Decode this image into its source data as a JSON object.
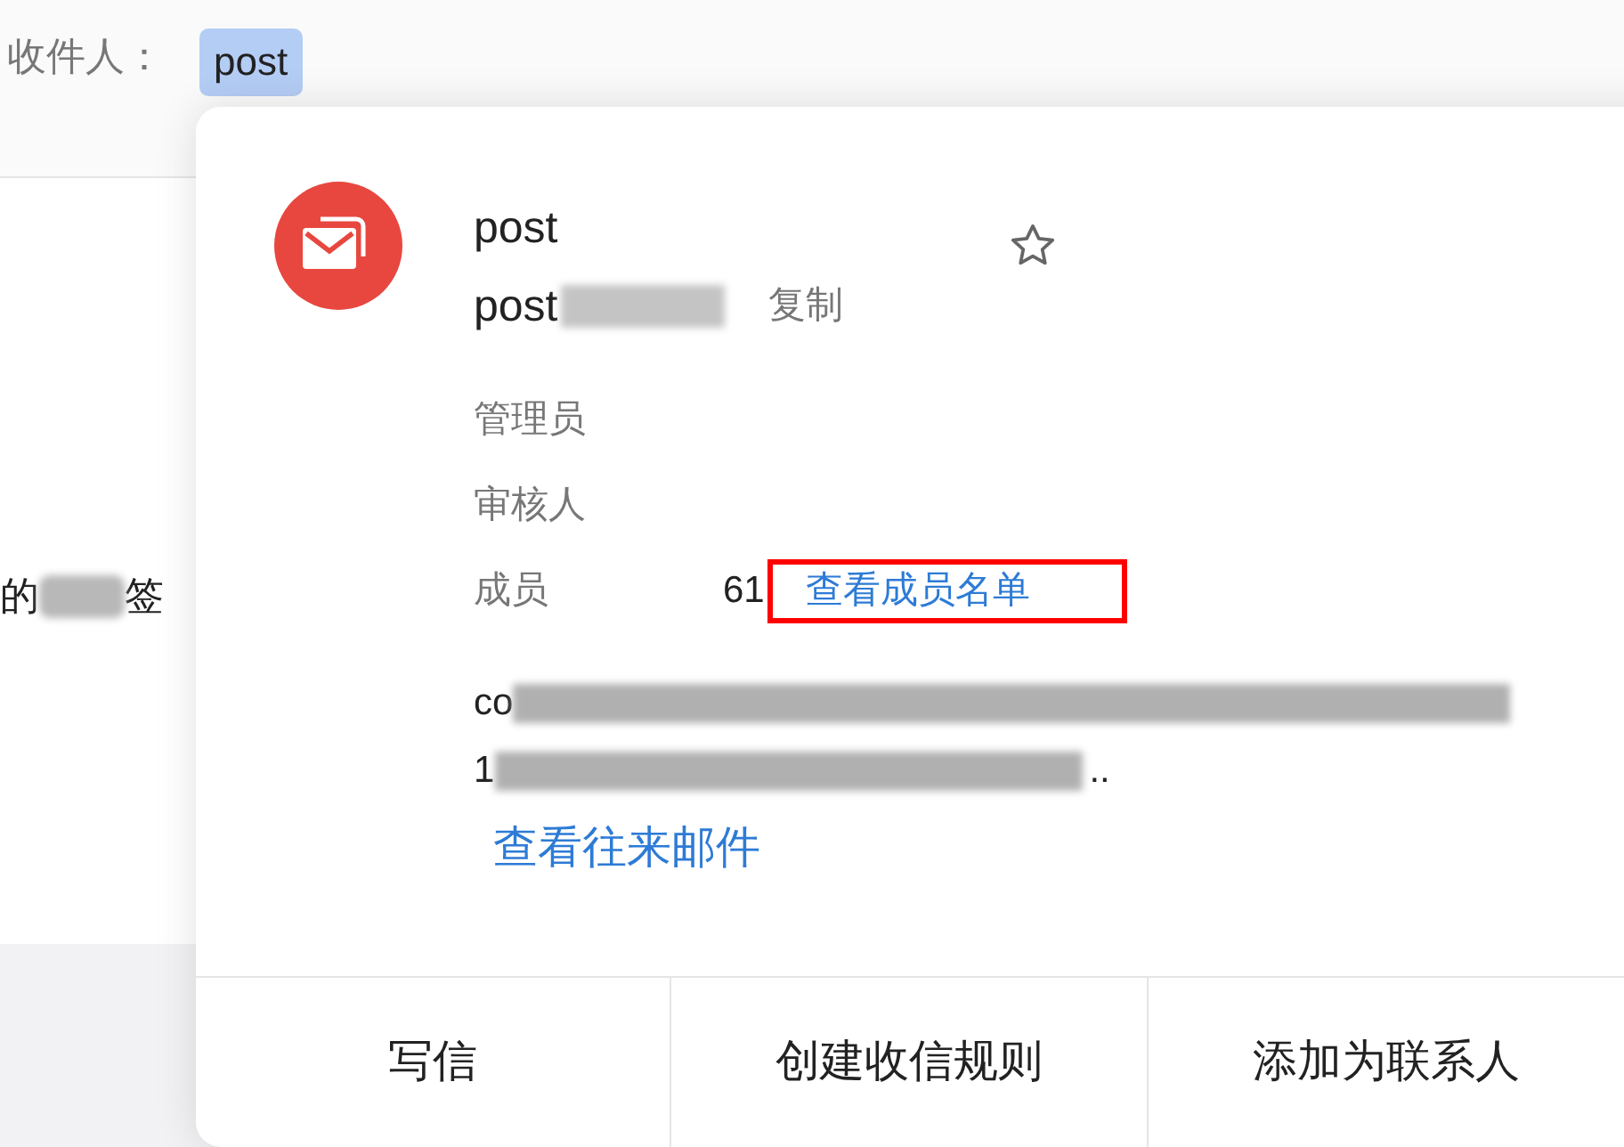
{
  "recipient": {
    "label": "收件人：",
    "chip": "post"
  },
  "background": {
    "fragments": [
      "的",
      "签"
    ]
  },
  "card": {
    "name": "post",
    "email": "post",
    "copy": "复制",
    "starred": false,
    "fields": [
      {
        "label": "管理员"
      },
      {
        "label": "审核人"
      },
      {
        "label": "成员",
        "value": "61",
        "link": "查看成员名单",
        "highlighted": true
      }
    ],
    "description": [
      {
        "text": "co"
      },
      {
        "text": "1",
        "suffix": ".."
      }
    ],
    "history_link": "查看往来邮件",
    "actions": [
      "写信",
      "创建收信规则",
      "添加为联系人"
    ]
  }
}
